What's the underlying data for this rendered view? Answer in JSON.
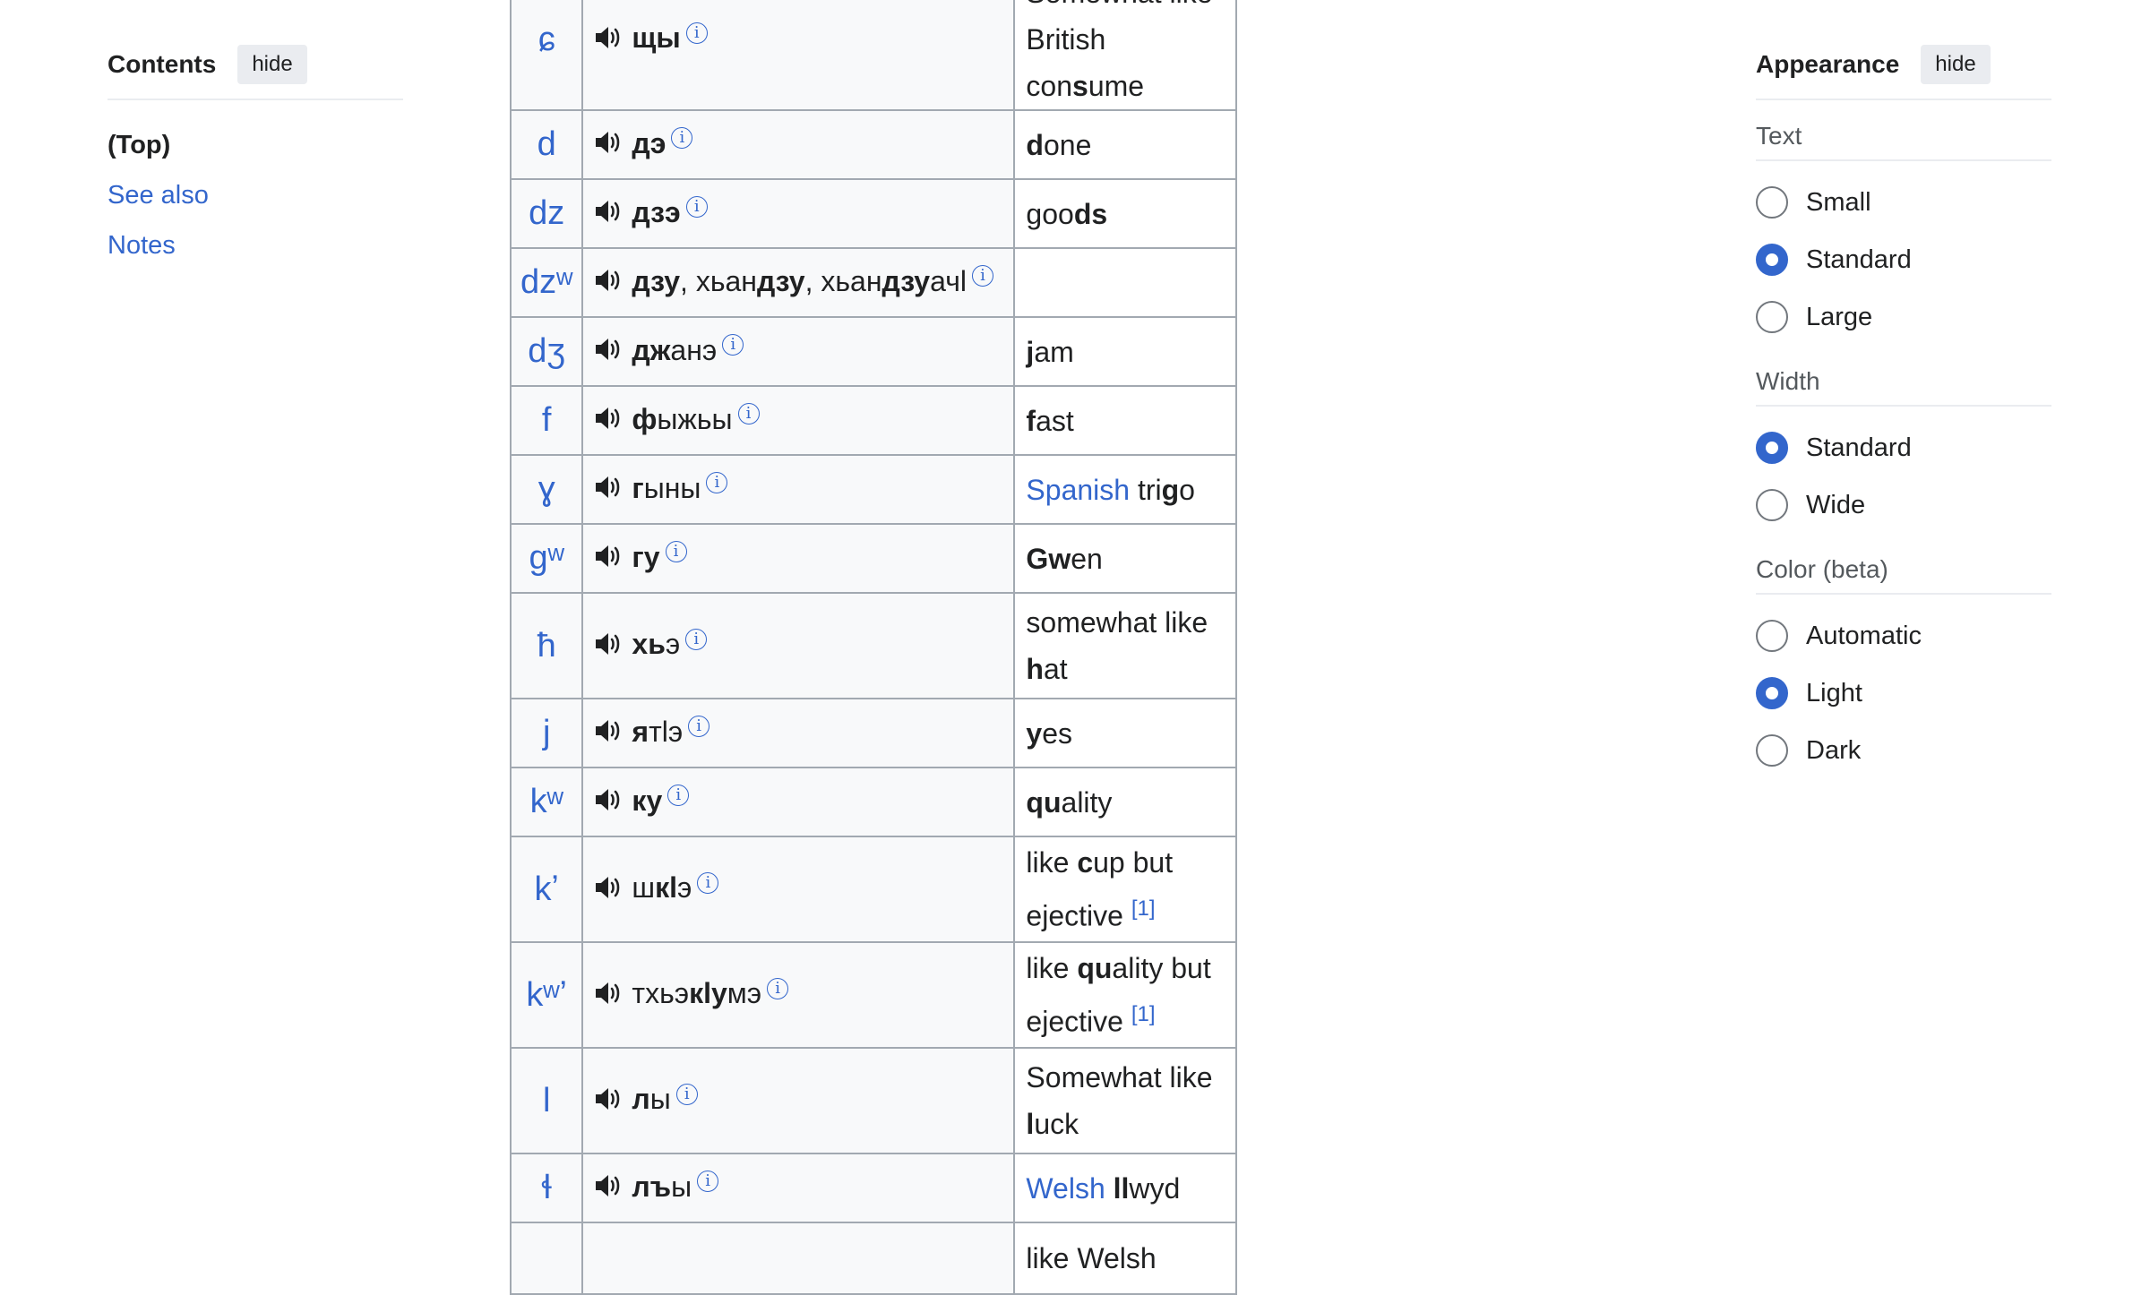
{
  "toc": {
    "title": "Contents",
    "hide_label": "hide",
    "items": [
      "(Top)",
      "See also",
      "Notes"
    ]
  },
  "appearance": {
    "title": "Appearance",
    "hide_label": "hide",
    "text": {
      "label": "Text",
      "options": [
        "Small",
        "Standard",
        "Large"
      ],
      "selected": "Standard"
    },
    "width": {
      "label": "Width",
      "options": [
        "Standard",
        "Wide"
      ],
      "selected": "Standard"
    },
    "color": {
      "label": "Color (beta)",
      "options": [
        "Automatic",
        "Light",
        "Dark"
      ],
      "selected": "Light"
    }
  },
  "table": {
    "rows": [
      {
        "ipa": "ɕ",
        "example": [
          [
            "b",
            "щы"
          ]
        ],
        "english": [
          [
            "n",
            "Somewhat like British con"
          ],
          [
            "b",
            "s"
          ],
          [
            "n",
            "ume"
          ]
        ]
      },
      {
        "ipa": "d",
        "example": [
          [
            "b",
            "дэ"
          ]
        ],
        "english": [
          [
            "b",
            "d"
          ],
          [
            "n",
            "one"
          ]
        ]
      },
      {
        "ipa": "dz",
        "example": [
          [
            "b",
            "дзэ"
          ]
        ],
        "english": [
          [
            "n",
            "goo"
          ],
          [
            "b",
            "ds"
          ]
        ]
      },
      {
        "ipa": "dzʷ",
        "example": [
          [
            "b",
            "дзу"
          ],
          [
            "n",
            ", хьан"
          ],
          [
            "b",
            "дзу"
          ],
          [
            "n",
            ", хьан"
          ],
          [
            "b",
            "дзу"
          ],
          [
            "n",
            "ачӏ"
          ]
        ],
        "english": []
      },
      {
        "ipa": "dʒ",
        "example": [
          [
            "b",
            "дж"
          ],
          [
            "n",
            "анэ"
          ]
        ],
        "english": [
          [
            "b",
            "j"
          ],
          [
            "n",
            "am"
          ]
        ]
      },
      {
        "ipa": "f",
        "example": [
          [
            "b",
            "ф"
          ],
          [
            "n",
            "ыжьы"
          ]
        ],
        "english": [
          [
            "b",
            "f"
          ],
          [
            "n",
            "ast"
          ]
        ]
      },
      {
        "ipa": "ɣ",
        "example": [
          [
            "b",
            "г"
          ],
          [
            "n",
            "ыны"
          ]
        ],
        "english": [
          [
            "l",
            "Spanish"
          ],
          [
            "n",
            " tri"
          ],
          [
            "b",
            "g"
          ],
          [
            "n",
            "o"
          ]
        ]
      },
      {
        "ipa": "ɡʷ",
        "example": [
          [
            "b",
            "гу"
          ]
        ],
        "english": [
          [
            "b",
            "Gw"
          ],
          [
            "n",
            "en"
          ]
        ]
      },
      {
        "ipa": "ħ",
        "example": [
          [
            "b",
            "хь"
          ],
          [
            "n",
            "э"
          ]
        ],
        "english": [
          [
            "n",
            "somewhat like "
          ],
          [
            "b",
            "h"
          ],
          [
            "n",
            "at"
          ]
        ]
      },
      {
        "ipa": "j",
        "example": [
          [
            "b",
            "я"
          ],
          [
            "n",
            "тӏэ"
          ]
        ],
        "english": [
          [
            "b",
            "y"
          ],
          [
            "n",
            "es"
          ]
        ]
      },
      {
        "ipa": "kʷ",
        "example": [
          [
            "b",
            "ку"
          ]
        ],
        "english": [
          [
            "b",
            "qu"
          ],
          [
            "n",
            "ality"
          ]
        ]
      },
      {
        "ipa": "kʼ",
        "example": [
          [
            "n",
            "ш"
          ],
          [
            "b",
            "кӏ"
          ],
          [
            "n",
            "э"
          ]
        ],
        "english": [
          [
            "n",
            "like "
          ],
          [
            "b",
            "c"
          ],
          [
            "n",
            "up but ejective "
          ],
          [
            "r",
            "[1]"
          ]
        ]
      },
      {
        "ipa": "kʷʼ",
        "example": [
          [
            "n",
            "тхьэ"
          ],
          [
            "b",
            "кӏу"
          ],
          [
            "n",
            "мэ"
          ]
        ],
        "english": [
          [
            "n",
            "like "
          ],
          [
            "b",
            "qu"
          ],
          [
            "n",
            "ality but ejective "
          ],
          [
            "r",
            "[1]"
          ]
        ]
      },
      {
        "ipa": "l",
        "example": [
          [
            "b",
            "л"
          ],
          [
            "n",
            "ы"
          ]
        ],
        "english": [
          [
            "n",
            "Somewhat like "
          ],
          [
            "b",
            "l"
          ],
          [
            "n",
            "uck"
          ]
        ]
      },
      {
        "ipa": "ɬ",
        "example": [
          [
            "b",
            "лъ"
          ],
          [
            "n",
            "ы"
          ]
        ],
        "english": [
          [
            "l",
            "Welsh"
          ],
          [
            "n",
            " "
          ],
          [
            "b",
            "ll"
          ],
          [
            "n",
            "wyd"
          ]
        ]
      },
      {
        "ipa": "",
        "example": [],
        "english": [
          [
            "n",
            "like Welsh"
          ]
        ]
      }
    ]
  }
}
